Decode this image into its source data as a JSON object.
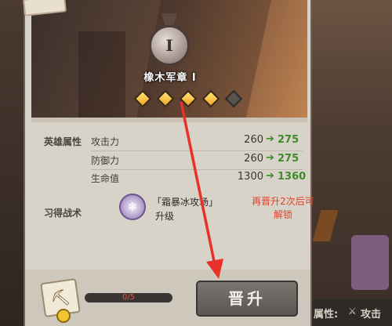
{
  "rank": {
    "numeral": "I",
    "title": "橡木军章 I",
    "stars_filled": 4,
    "stars_total": 5
  },
  "sections": {
    "attributes_label": "英雄属性",
    "skill_label": "习得战术"
  },
  "stats": [
    {
      "name": "攻击力",
      "current": "260",
      "next": "275"
    },
    {
      "name": "防御力",
      "current": "260",
      "next": "275"
    },
    {
      "name": "生命值",
      "current": "1300",
      "next": "1360"
    }
  ],
  "skill": {
    "name": "「霜暴冰攻场」",
    "sub": "升级",
    "unlock_note": "再晋升2次后可解锁"
  },
  "material": {
    "progress_text": "0/5",
    "progress_fraction": 0
  },
  "promote_button": "晋升",
  "bottom_strip": {
    "attr_label": "属性:",
    "attack_label": "攻击"
  },
  "colors": {
    "increase_green": "#3f8a2c",
    "warning_red": "#e2412b",
    "star_gold": "#f2a521",
    "annotation_red": "#e8312a"
  },
  "icons": {
    "medal": "medal-icon",
    "skill": "frost-skill-icon",
    "material": "promotion-material-icon",
    "arrow": "green-arrow-icon"
  }
}
